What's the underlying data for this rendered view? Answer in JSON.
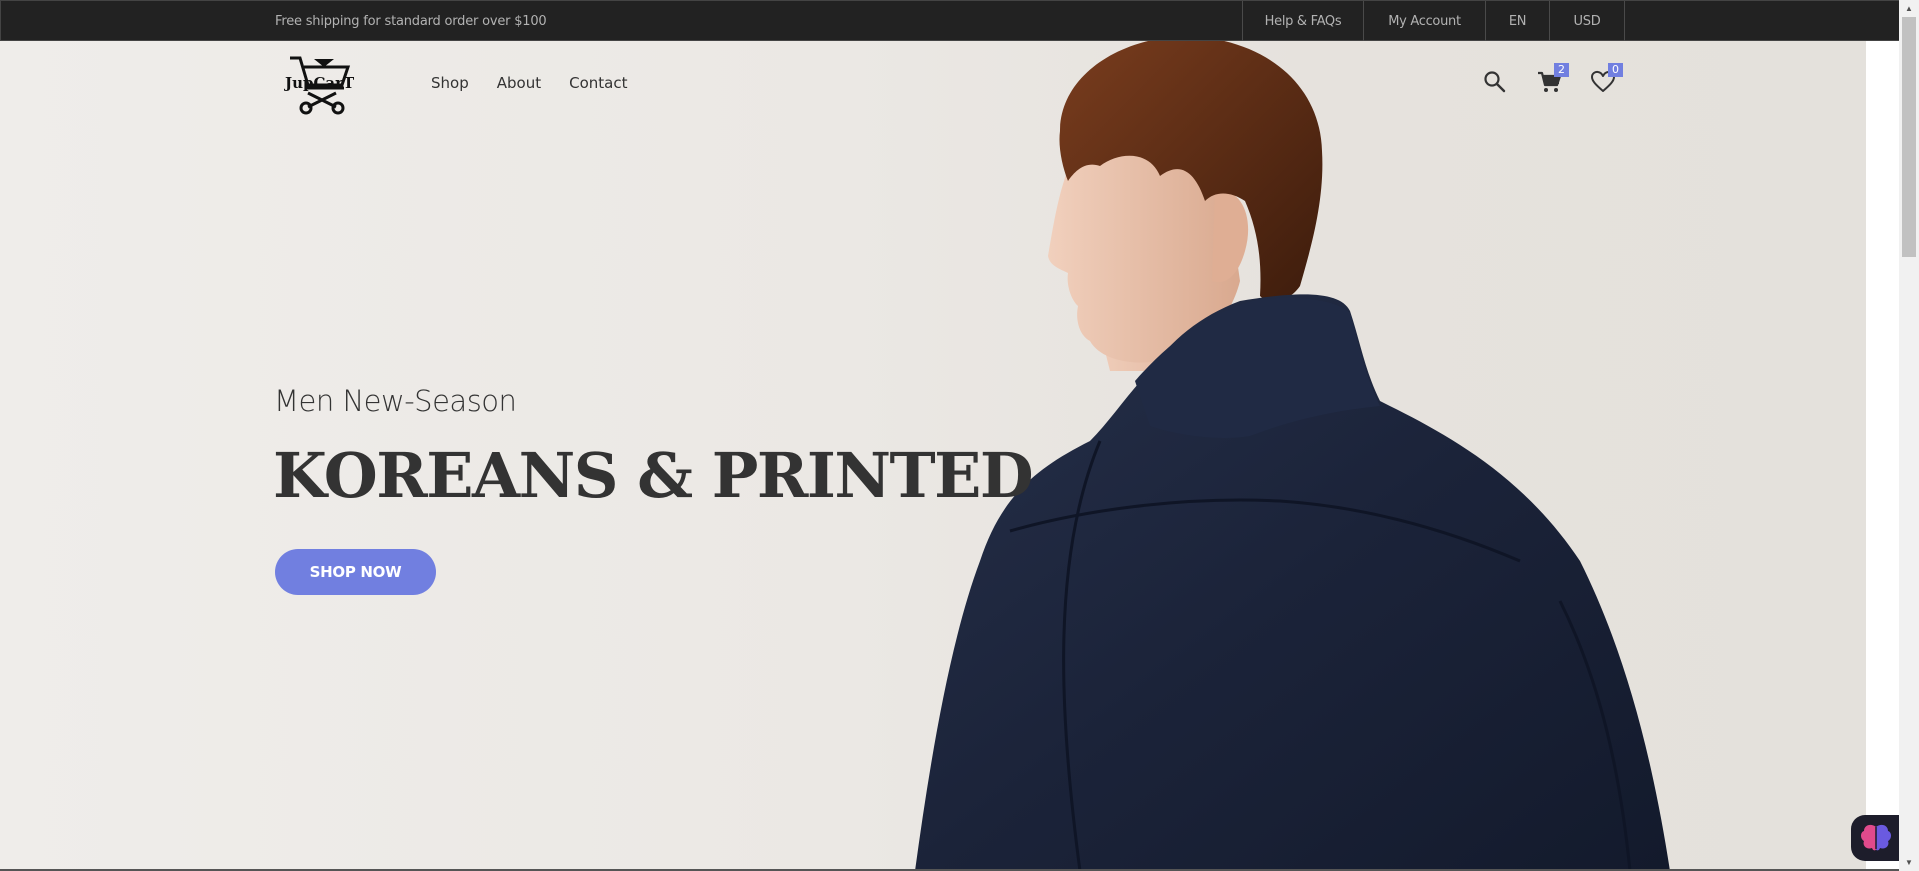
{
  "topbar": {
    "promo": "Free shipping for standard order over $100",
    "links": [
      {
        "label": "Help & FAQs"
      },
      {
        "label": "My Account"
      },
      {
        "label": "EN"
      },
      {
        "label": "USD"
      }
    ]
  },
  "header": {
    "logo_text": "JupCarT",
    "nav": [
      {
        "label": "Shop"
      },
      {
        "label": "About"
      },
      {
        "label": "Contact"
      }
    ],
    "cart_count": "2",
    "wishlist_count": "0",
    "icons": [
      "search-icon",
      "cart-icon",
      "heart-icon"
    ]
  },
  "hero": {
    "subtitle": "Men New-Season",
    "headline": "KOREANS & PRINTED",
    "cta_label": "SHOP NOW"
  },
  "colors": {
    "accent": "#717fe0",
    "topbar_bg": "#222222",
    "text_dark": "#333333"
  }
}
